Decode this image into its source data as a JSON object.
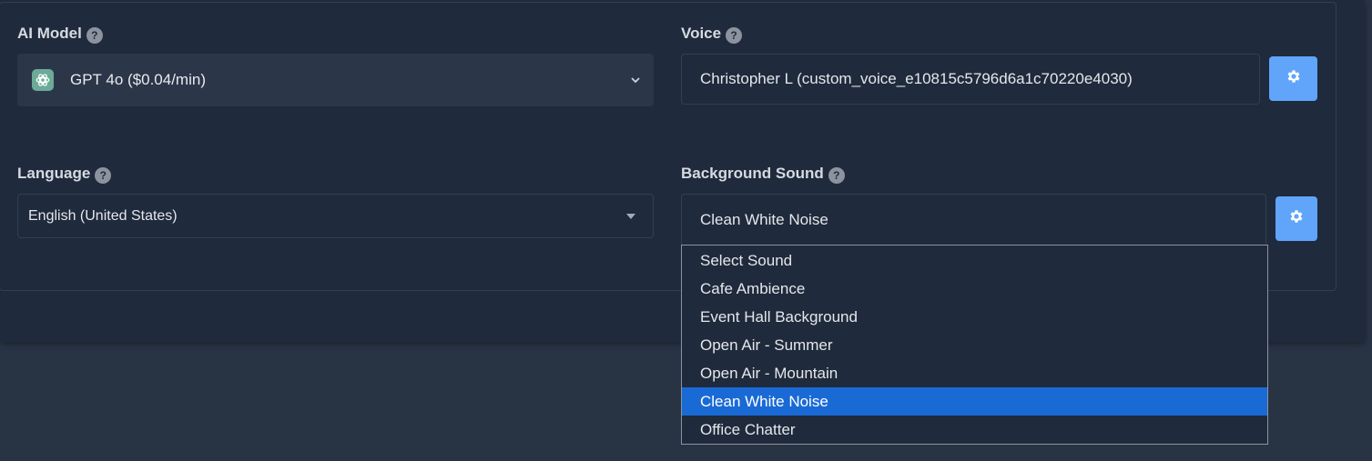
{
  "ai_model": {
    "label": "AI Model",
    "help": "?",
    "selected_value": "GPT 4o ($0.04/min)",
    "logo_icon": "openai-logo-icon"
  },
  "voice": {
    "label": "Voice",
    "help": "?",
    "value": "Christopher L (custom_voice_e10815c5796d6a1c70220e4030)",
    "settings_icon": "gear-icon"
  },
  "language": {
    "label": "Language",
    "help": "?",
    "selected_value": "English (United States)"
  },
  "background_sound": {
    "label": "Background Sound",
    "help": "?",
    "selected_value": "Clean White Noise",
    "settings_icon": "gear-icon",
    "options": [
      "Select Sound",
      "Cafe Ambience",
      "Event Hall Background",
      "Open Air - Summer",
      "Open Air - Mountain",
      "Clean White Noise",
      "Office Chatter"
    ],
    "highlighted_option": "Clean White Noise"
  },
  "colors": {
    "background": "#283344",
    "panel": "#1f2a3c",
    "accent_button": "#60a5fa",
    "highlight": "#1a6ad6"
  }
}
